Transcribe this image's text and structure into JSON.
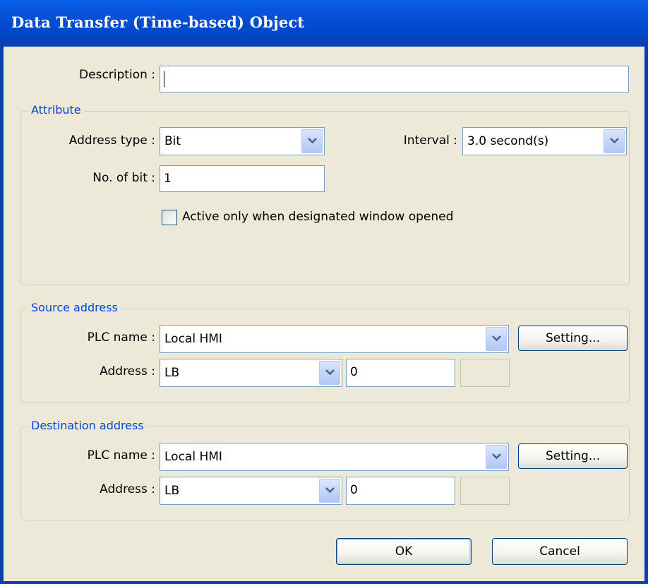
{
  "window": {
    "title": "Data Transfer (Time-based) Object"
  },
  "description": {
    "label": "Description :",
    "value": ""
  },
  "attribute": {
    "title": "Attribute",
    "address_type": {
      "label": "Address type :",
      "value": "Bit"
    },
    "interval": {
      "label": "Interval :",
      "value": "3.0  second(s)"
    },
    "no_of_bit": {
      "label": "No. of bit :",
      "value": "1"
    },
    "active_window": {
      "label": "Active only when designated window opened",
      "checked": false
    }
  },
  "source": {
    "title": "Source address",
    "plc_label": "PLC name :",
    "plc_value": "Local HMI",
    "setting_label": "Setting...",
    "address_label": "Address :",
    "address_type": "LB",
    "address_value": "0",
    "extra_value": ""
  },
  "destination": {
    "title": "Destination address",
    "plc_label": "PLC name :",
    "plc_value": "Local HMI",
    "setting_label": "Setting...",
    "address_label": "Address :",
    "address_type": "LB",
    "address_value": "0",
    "extra_value": ""
  },
  "buttons": {
    "ok": "OK",
    "cancel": "Cancel"
  },
  "colors": {
    "title_bar": "#0552d9",
    "dialog_bg": "#ece9d8",
    "group_title": "#0046d5",
    "input_border": "#7f9db9"
  },
  "icons": {
    "dropdown": "chevron-down-icon"
  }
}
